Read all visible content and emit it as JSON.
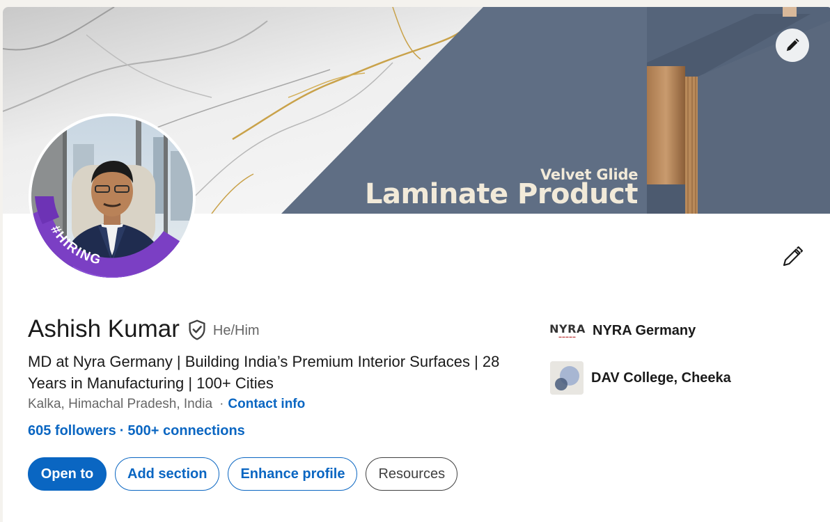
{
  "banner": {
    "subtitle": "Velvet Glide",
    "title": "Laminate Product"
  },
  "avatar": {
    "badge_text": "#HIRING",
    "frame_color": "#7b3fc4"
  },
  "profile": {
    "name": "Ashish Kumar",
    "pronouns": "He/Him",
    "headline": "MD at Nyra Germany | Building India’s Premium Interior Surfaces | 28 Years in Manufacturing | 100+ Cities",
    "location": "Kalka, Himachal Pradesh, India",
    "location_separator": "·",
    "contact_info": "Contact info",
    "followers": "605 followers",
    "network_separator": "·",
    "connections": "500+ connections"
  },
  "actions": {
    "open_to": "Open to",
    "add_section": "Add section",
    "enhance_profile": "Enhance profile",
    "resources": "Resources"
  },
  "experience": {
    "company_logo_text": "NYRA",
    "company": "NYRA Germany",
    "school": "DAV College, Cheeka"
  },
  "colors": {
    "accent": "#0a66c2",
    "text_primary": "#1a1a1a",
    "text_secondary": "#666666"
  },
  "icons": {
    "banner_edit": "pencil-icon",
    "profile_edit": "pencil-icon",
    "verified": "shield-check-icon"
  }
}
